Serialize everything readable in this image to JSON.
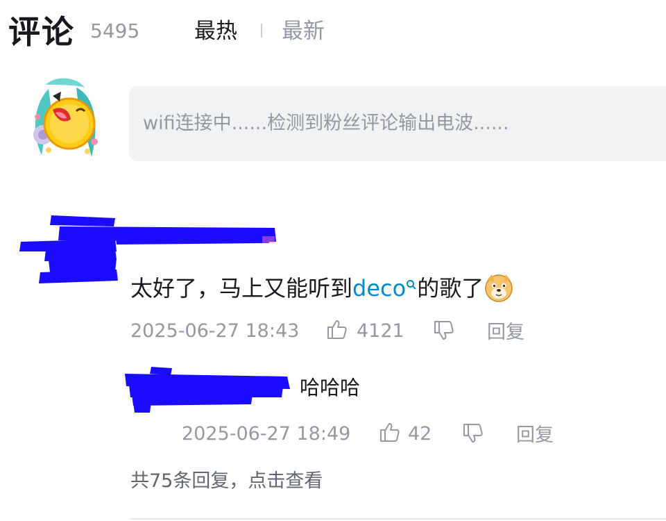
{
  "header": {
    "title": "评论",
    "comment_count": "5495",
    "sort_hot": "最热",
    "sort_new": "最新"
  },
  "composer": {
    "placeholder": "wifi连接中......检测到粉丝评论输出电波......"
  },
  "comment": {
    "text_before": "太好了，马上又能听到",
    "highlight": "deco",
    "text_after": "的歌了",
    "emoji": "doge-emoji",
    "time": "2025-06-27 18:43",
    "likes": "4121",
    "reply_label": "回复"
  },
  "reply": {
    "text": "哈哈哈",
    "time": "2025-06-27 18:49",
    "likes": "42",
    "reply_label": "回复"
  },
  "more_replies": "共75条回复，点击查看",
  "colors": {
    "link": "#008ac5",
    "muted": "#9499a0",
    "text": "#18191c",
    "composer_bg": "#f1f2f3",
    "redaction": "#1a0dff"
  },
  "icons": {
    "like": "thumb-up-icon",
    "dislike": "thumb-down-icon",
    "search": "search-icon"
  }
}
